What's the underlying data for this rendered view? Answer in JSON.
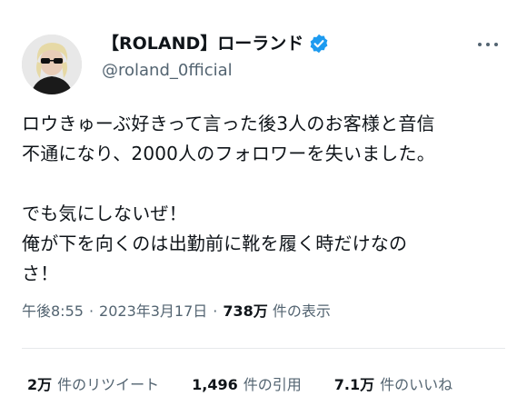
{
  "author": {
    "display_name": "【ROLAND】ローランド",
    "handle": "@roland_0fficial",
    "verified_icon": "verified-badge-icon",
    "avatar_icon": "avatar"
  },
  "tweet": {
    "lines": [
      "ロウきゅーぶ好きって言った後3人のお客様と音信",
      "不通になり、2000人のフォロワーを失いました。",
      "",
      "でも気にしないぜ！",
      "俺が下を向くのは出勤前に靴を履く時だけなの",
      "さ！"
    ]
  },
  "meta": {
    "time": "午後8:55",
    "separator": "·",
    "date": "2023年3月17日",
    "views_count": "738万",
    "views_label": "件の表示"
  },
  "stats": {
    "retweets_count": "2万",
    "retweets_label": "件のリツイート",
    "quotes_count": "1,496",
    "quotes_label": "件の引用",
    "likes_count": "7.1万",
    "likes_label": "件のいいね"
  },
  "colors": {
    "text": "#0f1419",
    "secondary": "#536471",
    "verified": "#1d9bf0",
    "divider": "#e6e9eb"
  }
}
